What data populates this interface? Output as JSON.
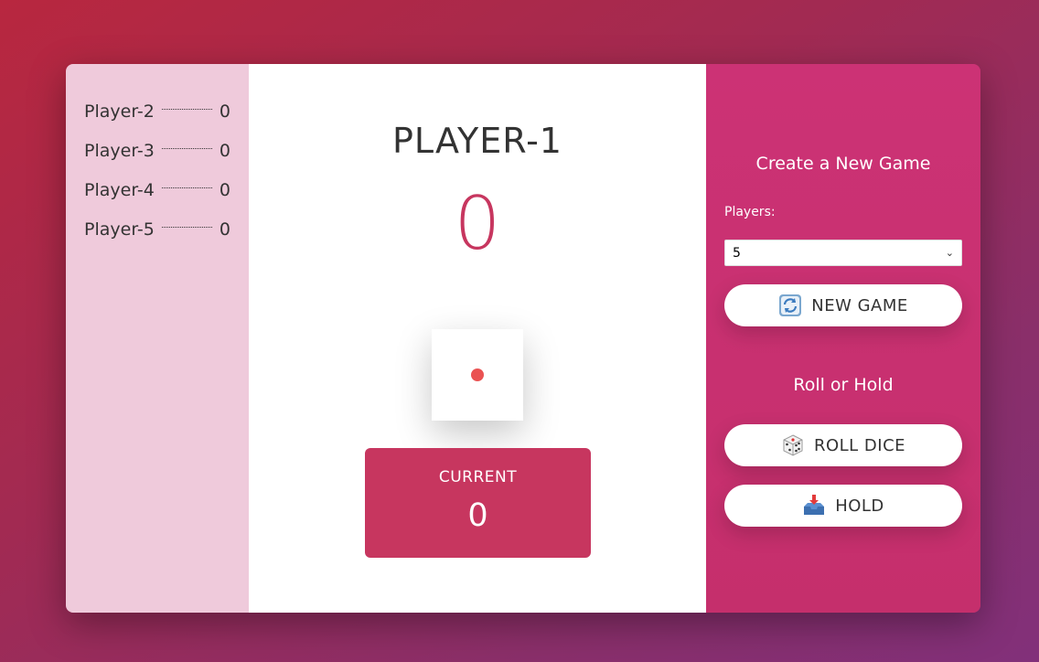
{
  "sidebar": {
    "players": [
      {
        "name": "Player-2",
        "score": "0"
      },
      {
        "name": "Player-3",
        "score": "0"
      },
      {
        "name": "Player-4",
        "score": "0"
      },
      {
        "name": "Player-5",
        "score": "0"
      }
    ]
  },
  "board": {
    "active_player": "PLAYER-1",
    "total_score": "0",
    "dice_value": 1,
    "current_label": "CURRENT",
    "current_value": "0"
  },
  "controls": {
    "new_game_heading": "Create a New Game",
    "players_label": "Players:",
    "players_selected": "5",
    "new_game_label": "NEW GAME",
    "roll_heading": "Roll or Hold",
    "roll_label": "ROLL DICE",
    "hold_label": "HOLD"
  },
  "icons": {
    "new_game": "refresh-icon",
    "roll": "dice-icon",
    "hold": "inbox-tray-icon"
  },
  "colors": {
    "accent": "#c7365f",
    "right_panel": "#cc3275",
    "left_panel": "#efcadb",
    "dice_pip": "#ea5252"
  }
}
